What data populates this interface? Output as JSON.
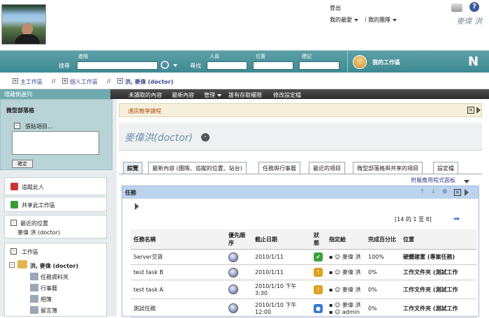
{
  "header": {
    "logout": "登出",
    "favorites": "我的最愛",
    "teams": "我的團隊",
    "user_name": "麥偉 洪"
  },
  "searchbar": {
    "advanced": "進階",
    "search": "搜尋",
    "find": "尋找",
    "people": "人員",
    "location": "位置",
    "tag": "標記",
    "workspace": "我的工作區",
    "logo": "N"
  },
  "breadcrumbs": [
    "主工作區",
    "個人工作區",
    "洪, 麥偉 (doctor)"
  ],
  "navbar": {
    "left": "隱藏側邊列",
    "items": [
      "未讀取的內容",
      "最新內容",
      "管理",
      "誰有存取權限",
      "修改設定檔"
    ]
  },
  "sidebar": {
    "blog_title": "微型部落格",
    "paste_label": "張貼項目...",
    "ok": "確定",
    "follow": "追蹤此人",
    "share": "共享此工作區",
    "recent_title": "最近的位置",
    "recent_item": "麥偉 洪 (doctor)",
    "ws_title": "工作區",
    "tree_root": "洪, 麥偉 (doctor)",
    "tree_items": [
      "任務資料夾",
      "行事曆",
      "相簿",
      "留言簿"
    ]
  },
  "main": {
    "tutorial": "通訊教學課程",
    "title": "麥偉洪(doctor)",
    "tabs": [
      "綜覽",
      "最新內容 (團隊、追蹤的位置、站台)",
      "任務與行事曆",
      "最近的項目",
      "微型部落格與共享的項目",
      "設定檔"
    ],
    "panel_link": "附屬應用程式面板",
    "tasks_title": "任務",
    "pager": "[14 的 1 至 8]",
    "columns": [
      "任務名稱",
      "優先順序",
      "截止日期",
      "狀態",
      "指定給",
      "完成百分比",
      "位置"
    ],
    "rows": [
      {
        "name": "Server交貨",
        "due": "2010/1/11",
        "status": "done",
        "assignee": "麥偉 洪",
        "assignee2": "",
        "pct": "100%",
        "loc": "硬體建置 (專案任務)"
      },
      {
        "name": "test task B",
        "due": "2010/1/11",
        "status": "warn",
        "assignee": "麥偉 洪",
        "assignee2": "",
        "pct": "0%",
        "loc": "工作文件夾 (測試工作"
      },
      {
        "name": "test task A",
        "due": "2010/1/10 下午 3:30",
        "status": "warn",
        "assignee": "麥偉 洪",
        "assignee2": "",
        "pct": "0%",
        "loc": "工作文件夾 (測試工作"
      },
      {
        "name": "測試任務",
        "due": "2010/1/10 下午 12:00",
        "status": "info",
        "assignee": "麥偉 洪",
        "assignee2": "admin",
        "pct": "0%",
        "loc": "工作文件夾 (測試工作"
      }
    ]
  },
  "colors": {
    "accent": "#3d8b93",
    "tasks_header": "#bcd3ee",
    "crumb": "#3b4b8a"
  }
}
